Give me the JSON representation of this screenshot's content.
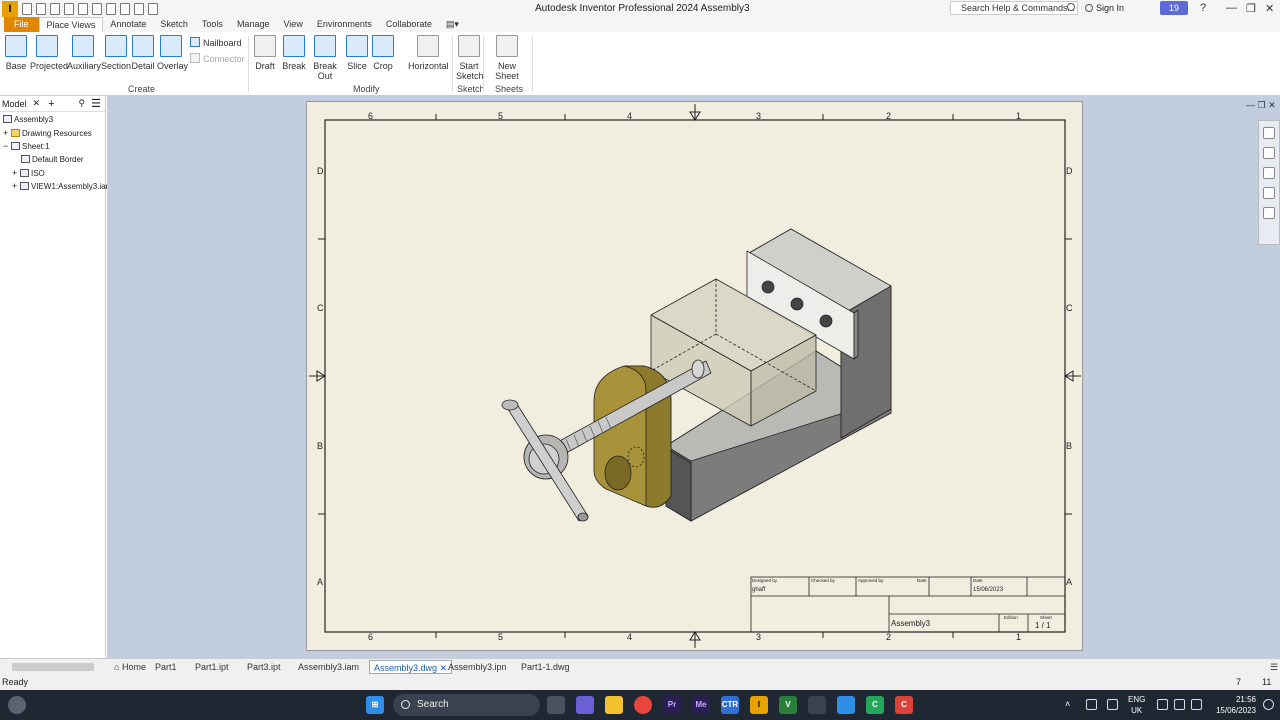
{
  "app": {
    "logo": "I",
    "title": "Autodesk Inventor Professional 2024   Assembly3",
    "help_search_placeholder": "Search Help & Commands...",
    "sign_in": "Sign In",
    "notification_count": "19"
  },
  "ribbon_tabs": [
    "File",
    "Place Views",
    "Annotate",
    "Sketch",
    "Tools",
    "Manage",
    "View",
    "Environments",
    "Collaborate"
  ],
  "ribbon": {
    "create": {
      "label": "Create",
      "base": "Base",
      "projected": "Projected",
      "auxiliary": "Auxiliary",
      "section": "Section",
      "detail": "Detail",
      "overlay": "Overlay",
      "nailboard": "Nailboard",
      "connector": "Connector"
    },
    "modify": {
      "label": "Modify",
      "draft": "Draft",
      "break": "Break",
      "break_out": "Break Out",
      "slice": "Slice",
      "crop": "Crop",
      "horizontal": "Horizontal"
    },
    "sketch": {
      "label": "Sketch",
      "start_sketch_1": "Start",
      "start_sketch_2": "Sketch"
    },
    "sheets": {
      "label": "Sheets",
      "new_sheet": "New Sheet"
    }
  },
  "browser": {
    "tab": "Model",
    "plus": "+",
    "tree": [
      "Assembly3",
      "Drawing Resources",
      "Sheet:1",
      "Default Border",
      "ISO",
      "VIEW1:Assembly3.iam"
    ]
  },
  "drawing": {
    "col_labels_top": [
      "6",
      "5",
      "4",
      "3",
      "2",
      "1"
    ],
    "col_labels_bottom": [
      "6",
      "5",
      "4",
      "3",
      "2",
      "1"
    ],
    "row_labels": [
      "D",
      "C",
      "B",
      "A"
    ],
    "title_block": {
      "designed_by_label": "Designed by",
      "designed_by": "ghaff",
      "checked_by_label": "Checked by",
      "approved_by_label": "Approved by",
      "date_label": "Date",
      "date_label_2": "Date",
      "date": "15/06/2023",
      "title": "Assembly3",
      "edition_label": "Edition",
      "sheet_label": "Sheet",
      "sheet": "1 / 1"
    }
  },
  "doc_tabs": [
    "Home",
    "Part1",
    "Part1.ipt",
    "Part3.ipt",
    "Assembly3.iam",
    "Assembly3.dwg",
    "Assembly3.ipn",
    "Part1-1.dwg"
  ],
  "status": {
    "text": "Ready",
    "num1": "7",
    "num2": "11"
  },
  "taskbar": {
    "search": "Search",
    "lang_1": "ENG",
    "lang_2": "UK",
    "time": "21:56",
    "date": "15/06/2023"
  },
  "colors": {
    "accent": "#e08600",
    "sheet_bg": "#f1eedf",
    "canvas_bg": "#c2cee0",
    "brass": "#a8923a",
    "steel": "#7a7a7a"
  }
}
